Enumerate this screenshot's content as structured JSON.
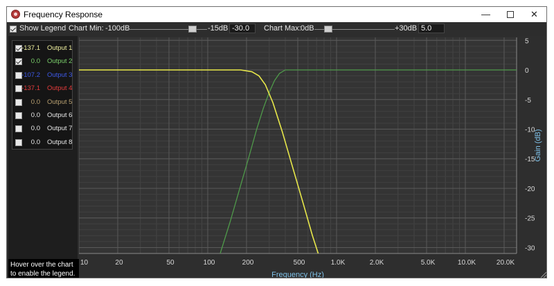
{
  "window": {
    "title": "Frequency Response",
    "controls": {
      "minimize": "—",
      "close": "✕"
    }
  },
  "toolbar": {
    "show_legend_label": "Show Legend",
    "show_legend_checked": true,
    "chart_min_label": "Chart Min:",
    "chart_min_range_low": "-100dB",
    "chart_min_range_high": "-15dB",
    "chart_min_value": "-30.0",
    "chart_min_slider": 0.82,
    "chart_max_label": "Chart Max:",
    "chart_max_range_low": "0dB",
    "chart_max_range_high": "+30dB",
    "chart_max_value": "5.0",
    "chart_max_slider": 0.17
  },
  "legend": {
    "outputs": [
      {
        "value": "-137.1",
        "name": "Output 1",
        "checked": true,
        "color": "#f2f2a0"
      },
      {
        "value": "0.0",
        "name": "Output 2",
        "checked": true,
        "color": "#7acf6a"
      },
      {
        "value": "-107.2",
        "name": "Output 3",
        "checked": false,
        "color": "#3d59e8"
      },
      {
        "value": "-137.1",
        "name": "Output 4",
        "checked": false,
        "color": "#e53b3b"
      },
      {
        "value": "0.0",
        "name": "Output 5",
        "checked": false,
        "color": "#b8a070"
      },
      {
        "value": "0.0",
        "name": "Output 6",
        "checked": false,
        "color": "#e8e8e8"
      },
      {
        "value": "0.0",
        "name": "Output 7",
        "checked": false,
        "color": "#e8e8e8"
      },
      {
        "value": "0.0",
        "name": "Output 8",
        "checked": false,
        "color": "#e8e8e8"
      }
    ],
    "hint": "Hover over the chart to enable the legend."
  },
  "chart_data": {
    "type": "line",
    "xlabel": "Frequency (Hz)",
    "ylabel": "Gain (dB)",
    "x_scale": "log",
    "xlim": [
      10,
      25000
    ],
    "ylim": [
      -31,
      5.5
    ],
    "grid": true,
    "x_ticks": [
      {
        "value": 10,
        "label": "10"
      },
      {
        "value": 20,
        "label": "20"
      },
      {
        "value": 50,
        "label": "50"
      },
      {
        "value": 100,
        "label": "100"
      },
      {
        "value": 200,
        "label": "200"
      },
      {
        "value": 500,
        "label": "500"
      },
      {
        "value": 1000,
        "label": "1.0K"
      },
      {
        "value": 2000,
        "label": "2.0K"
      },
      {
        "value": 5000,
        "label": "5.0K"
      },
      {
        "value": 10000,
        "label": "10.0K"
      },
      {
        "value": 20000,
        "label": "20.0K"
      }
    ],
    "y_ticks": [
      {
        "value": 5,
        "label": "5"
      },
      {
        "value": 0,
        "label": "0"
      },
      {
        "value": -5,
        "label": "-5"
      },
      {
        "value": -10,
        "label": "-10"
      },
      {
        "value": -15,
        "label": "-15"
      },
      {
        "value": -20,
        "label": "-20"
      },
      {
        "value": -25,
        "label": "-25"
      },
      {
        "value": -30,
        "label": "-30"
      }
    ],
    "series": [
      {
        "color": "#e8e84a",
        "x": [
          10,
          100,
          180,
          220,
          250,
          280,
          320,
          380,
          450,
          550,
          650,
          720
        ],
        "y": [
          0,
          0,
          0,
          -0.3,
          -1.0,
          -2.5,
          -5.5,
          -10.5,
          -16.0,
          -22.5,
          -28.0,
          -31.0
        ]
      },
      {
        "color": "#4f9a4a",
        "x": [
          125,
          150,
          180,
          210,
          240,
          270,
          300,
          330,
          360,
          400,
          1000,
          25000
        ],
        "y": [
          -31,
          -25.5,
          -19.5,
          -14.5,
          -10,
          -6.5,
          -3.8,
          -1.8,
          -0.6,
          0,
          0,
          0
        ]
      }
    ]
  }
}
